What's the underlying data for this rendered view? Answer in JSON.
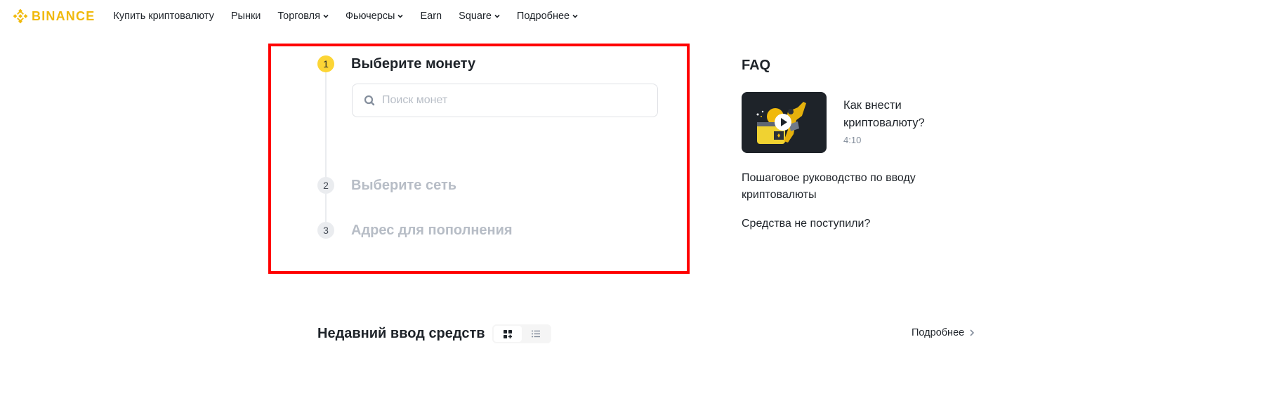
{
  "header": {
    "brand": "BINANCE",
    "brand_color": "#f0b90b",
    "nav": [
      {
        "label": "Купить криптовалюту",
        "has_dropdown": false
      },
      {
        "label": "Рынки",
        "has_dropdown": false
      },
      {
        "label": "Торговля",
        "has_dropdown": true
      },
      {
        "label": "Фьючерсы",
        "has_dropdown": true
      },
      {
        "label": "Earn",
        "has_dropdown": false
      },
      {
        "label": "Square",
        "has_dropdown": true
      },
      {
        "label": "Подробнее",
        "has_dropdown": true
      }
    ]
  },
  "deposit": {
    "steps": [
      {
        "number": "1",
        "title": "Выберите монету",
        "state": "active"
      },
      {
        "number": "2",
        "title": "Выберите сеть",
        "state": "inactive"
      },
      {
        "number": "3",
        "title": "Адрес для пополнения",
        "state": "inactive"
      }
    ],
    "search": {
      "placeholder": "Поиск монет",
      "value": "",
      "icon": "search-icon"
    },
    "highlight_color": "#ff0000",
    "active_step_color": "#fcd535"
  },
  "faq": {
    "title": "FAQ",
    "video": {
      "title": "Как внести криптовалюту?",
      "duration": "4:10",
      "icon": "play-icon"
    },
    "links": [
      "Пошаговое руководство по вводу криптовалюты",
      "Средства не поступили?"
    ]
  },
  "recent": {
    "title": "Недавний ввод средств",
    "view_modes": [
      {
        "name": "grid",
        "icon": "grid-view-icon",
        "active": true
      },
      {
        "name": "list",
        "icon": "list-view-icon",
        "active": false
      }
    ],
    "more_label": "Подробнее"
  }
}
